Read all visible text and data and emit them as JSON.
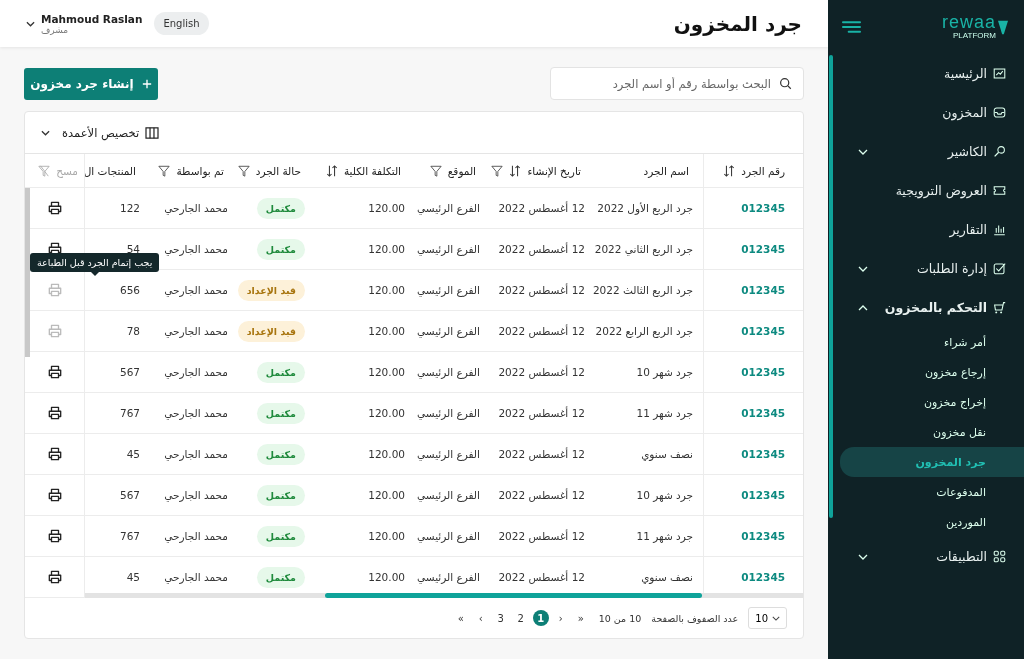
{
  "header": {
    "title": "جرد المخزون",
    "language_button": "English",
    "user": {
      "name": "Mahmoud Raslan",
      "role": "مشرف"
    }
  },
  "toolbar": {
    "search": {
      "placeholder": "البحث بواسطة رقم أو اسم الجرد"
    },
    "create_button": "إنشاء جرد مخزون"
  },
  "table": {
    "customize_columns": "تخصيص الأعمدة",
    "columns": [
      {
        "label": "رقم الجرد",
        "sort": true,
        "filter": false
      },
      {
        "label": "اسم الجرد",
        "sort": false,
        "filter": false
      },
      {
        "label": "تاريخ الإنشاء",
        "sort": true,
        "filter": true
      },
      {
        "label": "الموقع",
        "sort": false,
        "filter": true
      },
      {
        "label": "التكلفة الكلية",
        "sort": true,
        "filter": false
      },
      {
        "label": "حالة الجرد",
        "sort": false,
        "filter": true
      },
      {
        "label": "تم بواسطة",
        "sort": false,
        "filter": true
      },
      {
        "label": "المنتجات ال"
      },
      {
        "label": "مسح",
        "sort": false,
        "filter": false,
        "kind": "clear"
      }
    ],
    "rows": [
      {
        "number": "012345",
        "name": "جرد الربع الأول 2022",
        "date": "12 أغسطس 2022",
        "location": "الفرع الرئيسي",
        "cost": "120.00",
        "status": "مكتمل",
        "kind": "complete",
        "by": "محمد الجارحي",
        "products": "122",
        "print_disabled": false
      },
      {
        "number": "012345",
        "name": "جرد الربع الثاني 2022",
        "date": "12 أغسطس 2022",
        "location": "الفرع الرئيسي",
        "cost": "120.00",
        "status": "مكتمل",
        "kind": "complete",
        "by": "محمد الجارحي",
        "products": "54",
        "print_disabled": false
      },
      {
        "number": "012345",
        "name": "جرد الربع الثالث 2022",
        "date": "12 أغسطس 2022",
        "location": "الفرع الرئيسي",
        "cost": "120.00",
        "status": "قيد الإعداد",
        "kind": "preparing",
        "by": "محمد الجارحي",
        "products": "656",
        "print_disabled": true
      },
      {
        "number": "012345",
        "name": "جرد الربع الرابع 2022",
        "date": "12 أغسطس 2022",
        "location": "الفرع الرئيسي",
        "cost": "120.00",
        "status": "قيد الإعداد",
        "kind": "preparing",
        "by": "محمد الجارحي",
        "products": "78",
        "print_disabled": true
      },
      {
        "number": "012345",
        "name": "جرد شهر 10",
        "date": "12 أغسطس 2022",
        "location": "الفرع الرئيسي",
        "cost": "120.00",
        "status": "مكتمل",
        "kind": "complete",
        "by": "محمد الجارحي",
        "products": "567",
        "print_disabled": false
      },
      {
        "number": "012345",
        "name": "جرد شهر 11",
        "date": "12 أغسطس 2022",
        "location": "الفرع الرئيسي",
        "cost": "120.00",
        "status": "مكتمل",
        "kind": "complete",
        "by": "محمد الجارحي",
        "products": "767",
        "print_disabled": false
      },
      {
        "number": "012345",
        "name": "نصف سنوي",
        "date": "12 أغسطس 2022",
        "location": "الفرع الرئيسي",
        "cost": "120.00",
        "status": "مكتمل",
        "kind": "complete",
        "by": "محمد الجارحي",
        "products": "45",
        "print_disabled": false
      },
      {
        "number": "012345",
        "name": "جرد شهر 10",
        "date": "12 أغسطس 2022",
        "location": "الفرع الرئيسي",
        "cost": "120.00",
        "status": "مكتمل",
        "kind": "complete",
        "by": "محمد الجارحي",
        "products": "567",
        "print_disabled": false
      },
      {
        "number": "012345",
        "name": "جرد شهر 11",
        "date": "12 أغسطس 2022",
        "location": "الفرع الرئيسي",
        "cost": "120.00",
        "status": "مكتمل",
        "kind": "complete",
        "by": "محمد الجارحي",
        "products": "767",
        "print_disabled": false
      },
      {
        "number": "012345",
        "name": "نصف سنوي",
        "date": "12 أغسطس 2022",
        "location": "الفرع الرئيسي",
        "cost": "120.00",
        "status": "مكتمل",
        "kind": "complete",
        "by": "محمد الجارحي",
        "products": "45",
        "print_disabled": false
      }
    ],
    "tooltip": "يجب إتمام الجرد قبل الطباعة",
    "pagination": {
      "pages": [
        {
          "label": "1",
          "selected": true
        },
        {
          "label": "2",
          "selected": false
        },
        {
          "label": "3",
          "selected": false
        }
      ],
      "first": "»",
      "prev": "›",
      "next": "‹",
      "last": "«",
      "range": "10 من 10",
      "rows_label": "عدد الصفوف بالصفحة",
      "rows_value": "10"
    }
  },
  "sidebar": {
    "logo": "rewaa",
    "logo_sub": "PLATFORM",
    "items": [
      {
        "label": "الرئيسية",
        "expandable": false,
        "expanded": false
      },
      {
        "label": "المخزون",
        "expandable": false,
        "expanded": false
      },
      {
        "label": "الكاشير",
        "expandable": true,
        "expanded": false
      },
      {
        "label": "العروض الترويجية",
        "expandable": false,
        "expanded": false
      },
      {
        "label": "التقارير",
        "expandable": false,
        "expanded": false
      },
      {
        "label": "إدارة الطلبات",
        "expandable": true,
        "expanded": false
      },
      {
        "label": "التحكم بالمخزون",
        "expandable": true,
        "expanded": true,
        "children": [
          {
            "label": "أمر شراء",
            "selected": false
          },
          {
            "label": "إرجاع مخزون",
            "selected": false
          },
          {
            "label": "إخراج مخزون",
            "selected": false
          },
          {
            "label": "نقل مخزون",
            "selected": false
          },
          {
            "label": "جرد المخزون",
            "selected": true
          },
          {
            "label": "المدفوعات",
            "selected": false
          },
          {
            "label": "الموردين",
            "selected": false
          }
        ]
      },
      {
        "label": "التطبيقات",
        "expandable": true,
        "expanded": false
      }
    ]
  }
}
